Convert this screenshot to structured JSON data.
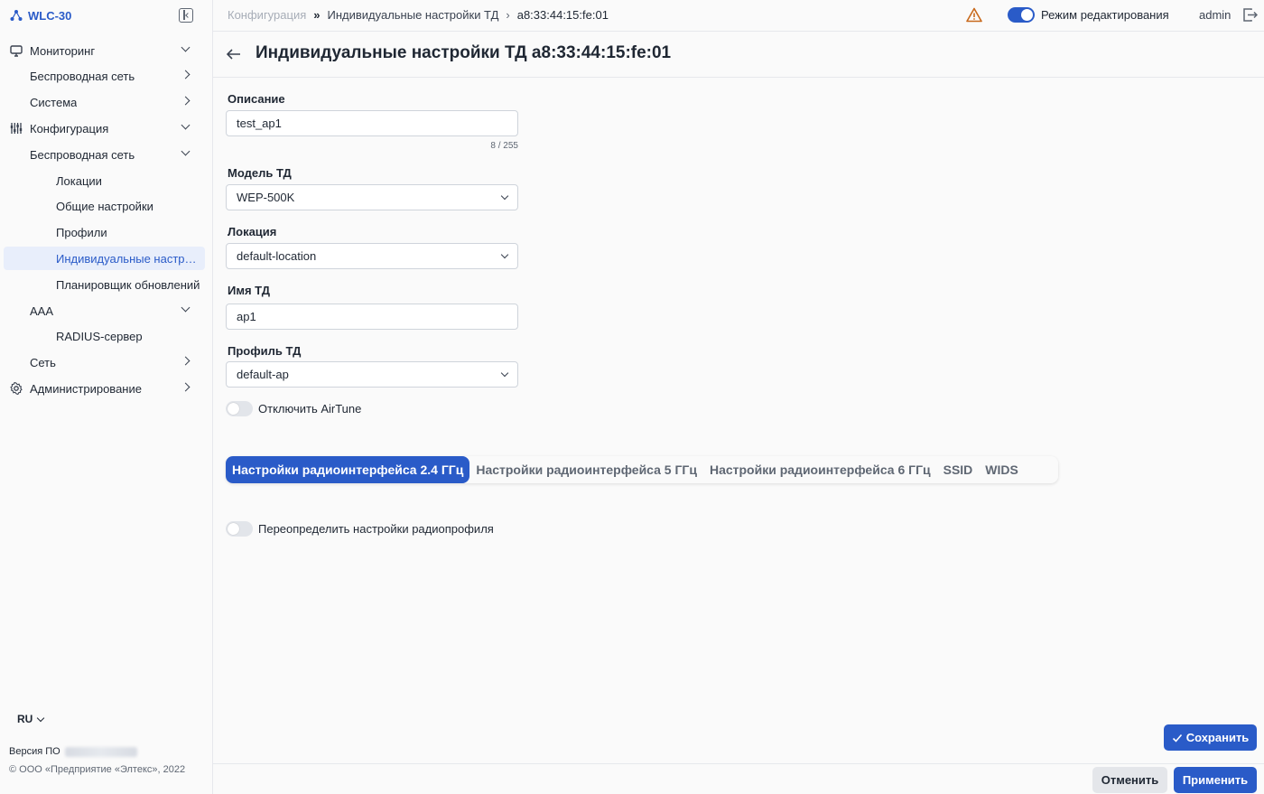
{
  "brand": {
    "name": "WLC-30"
  },
  "sidebar": {
    "items": [
      {
        "label": "Мониторинг"
      },
      {
        "label": "Беспроводная сеть"
      },
      {
        "label": "Система"
      },
      {
        "label": "Конфигурация"
      },
      {
        "label": "Беспроводная сеть"
      },
      {
        "label": "Локации"
      },
      {
        "label": "Общие настройки"
      },
      {
        "label": "Профили"
      },
      {
        "label": "Индивидуальные настройки ТД"
      },
      {
        "label": "Планировщик обновлений"
      },
      {
        "label": "AAA"
      },
      {
        "label": "RADIUS-сервер"
      },
      {
        "label": "Сеть"
      },
      {
        "label": "Администрирование"
      }
    ],
    "language": "RU",
    "version_label": "Версия ПО",
    "copyright": "© ООО «Предприятие «Элтекс», 2022"
  },
  "header": {
    "breadcrumbs": [
      "Конфигурация",
      "Индивидуальные настройки ТД",
      "a8:33:44:15:fe:01"
    ],
    "edit_mode_label": "Режим редактирования",
    "edit_mode_on": true,
    "user": "admin"
  },
  "page": {
    "title": "Индивидуальные настройки ТД a8:33:44:15:fe:01"
  },
  "form": {
    "description_label": "Описание",
    "description_value": "test_ap1",
    "description_counter": "8 / 255",
    "model_label": "Модель ТД",
    "model_value": "WEP-500K",
    "location_label": "Локация",
    "location_value": "default-location",
    "name_label": "Имя ТД",
    "name_value": "ap1",
    "profile_label": "Профиль ТД",
    "profile_value": "default-ap",
    "airtune_label": "Отключить AirTune",
    "airtune_on": false
  },
  "tabs": [
    {
      "label": "Настройки радиоинтерфейса 2.4 ГГц",
      "active": true
    },
    {
      "label": "Настройки радиоинтерфейса 5 ГГц",
      "active": false
    },
    {
      "label": "Настройки радиоинтерфейса 6 ГГц",
      "active": false
    },
    {
      "label": "SSID",
      "active": false
    },
    {
      "label": "WIDS",
      "active": false
    }
  ],
  "radio": {
    "override_label": "Переопределить настройки радиопрофиля",
    "override_on": false
  },
  "actions": {
    "save": "Сохранить",
    "cancel": "Отменить",
    "apply": "Применить"
  },
  "colors": {
    "accent": "#2a5bc8",
    "warning": "#c8691c"
  }
}
